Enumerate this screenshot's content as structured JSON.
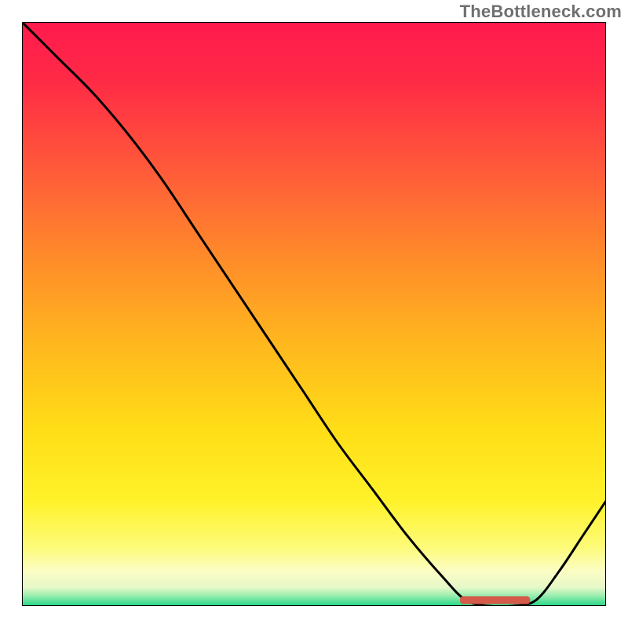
{
  "watermark": "TheBottleneck.com",
  "chart_data": {
    "type": "line",
    "title": "",
    "xlabel": "",
    "ylabel": "",
    "xlim": [
      0,
      100
    ],
    "ylim": [
      0,
      100
    ],
    "grid": false,
    "line_color": "#000000",
    "marker": {
      "color": "#d45a4a",
      "x_start": 75,
      "x_end": 87,
      "y": 1
    },
    "gradient_stops": [
      {
        "offset": 0.0,
        "color": "#ff1a4d"
      },
      {
        "offset": 0.1,
        "color": "#ff2a46"
      },
      {
        "offset": 0.25,
        "color": "#ff593a"
      },
      {
        "offset": 0.4,
        "color": "#ff8a2a"
      },
      {
        "offset": 0.55,
        "color": "#ffb71e"
      },
      {
        "offset": 0.7,
        "color": "#ffde17"
      },
      {
        "offset": 0.82,
        "color": "#fff22a"
      },
      {
        "offset": 0.9,
        "color": "#fdfb7a"
      },
      {
        "offset": 0.94,
        "color": "#fbfdc4"
      },
      {
        "offset": 0.968,
        "color": "#e7f8c8"
      },
      {
        "offset": 0.982,
        "color": "#9ceeb0"
      },
      {
        "offset": 1.0,
        "color": "#23d586"
      }
    ],
    "x": [
      0,
      6,
      12,
      18,
      24,
      30,
      36,
      42,
      48,
      54,
      60,
      66,
      72,
      76,
      80,
      84,
      88,
      92,
      96,
      100
    ],
    "values": [
      100,
      94,
      88,
      81,
      73,
      64,
      55,
      46,
      37,
      28,
      20,
      12,
      5,
      1,
      0,
      0,
      1,
      6,
      12,
      18
    ]
  }
}
